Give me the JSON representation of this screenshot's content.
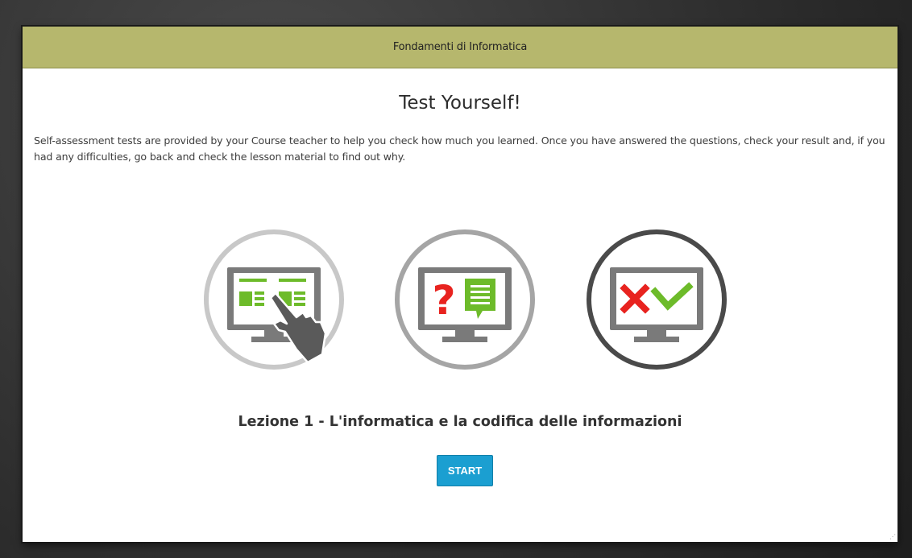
{
  "window": {
    "title": "Fondamenti di Informatica"
  },
  "main": {
    "heading": "Test Yourself!",
    "description": "Self-assessment tests are provided by your Course teacher to help you check how much you learned. Once you have answered the questions, check your result and, if you had any difficulties, go back and check the lesson material to find out why.",
    "lesson_title": "Lezione 1 - L'informatica e la codifica delle informazioni",
    "start_label": "START"
  },
  "icons": [
    {
      "name": "select-answer-monitor-icon",
      "ring_color": "#c8c8c8"
    },
    {
      "name": "question-monitor-icon",
      "ring_color": "#a5a5a5"
    },
    {
      "name": "result-monitor-icon",
      "ring_color": "#4a4a4a"
    }
  ],
  "colors": {
    "topbar": "#b6b76d",
    "accent_green": "#6dbb2a",
    "accent_red": "#e8231f",
    "button": "#1b9fd1",
    "monitor": "#7a7a7a"
  }
}
